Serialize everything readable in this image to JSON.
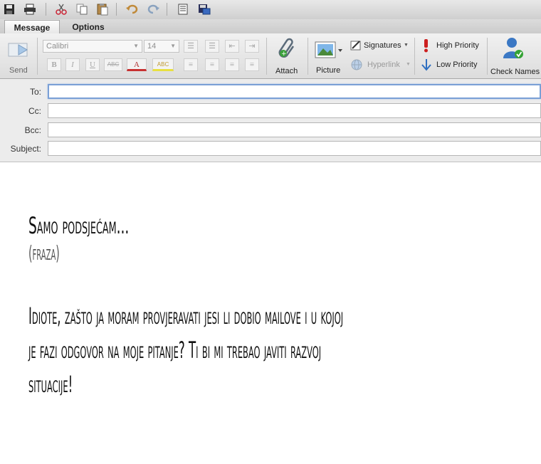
{
  "window": {
    "ribbon_tabs": [
      "Message",
      "Options"
    ]
  },
  "quick_access": [
    "save-icon",
    "print-icon",
    "cut-icon",
    "copy-icon",
    "paste-icon",
    "undo-icon",
    "redo-icon",
    "address-book-icon",
    "save-as-icon"
  ],
  "ribbon": {
    "send_label": "Send",
    "font_name": "Calibri",
    "font_size": "14",
    "bold": "B",
    "italic": "I",
    "underline": "U",
    "strikethrough": "ABC",
    "font_color": "A",
    "highlight": "ABC",
    "attach_label": "Attach",
    "picture_label": "Picture",
    "signatures_label": "Signatures",
    "hyperlink_label": "Hyperlink",
    "high_priority_label": "High Priority",
    "low_priority_label": "Low Priority",
    "check_names_label": "Check Names"
  },
  "fields": {
    "to_label": "To:",
    "cc_label": "Cc:",
    "bcc_label": "Bcc:",
    "subject_label": "Subject:",
    "to_value": "",
    "cc_value": "",
    "bcc_value": "",
    "subject_value": ""
  },
  "body": {
    "heading": "Samo podsjećam...",
    "subheading": "(fraza)",
    "lines": [
      "Idiote, zašto ja moram provjeravati jesi li dobio mailove i u kojoj",
      "je fazi odgovor na moje pitanje? Ti bi mi trebao javiti razvoj",
      "situacije!"
    ]
  },
  "colors": {
    "priority_red": "#cc1f1f",
    "priority_blue": "#2f6fc0",
    "focus_border": "#7aa0d6"
  }
}
